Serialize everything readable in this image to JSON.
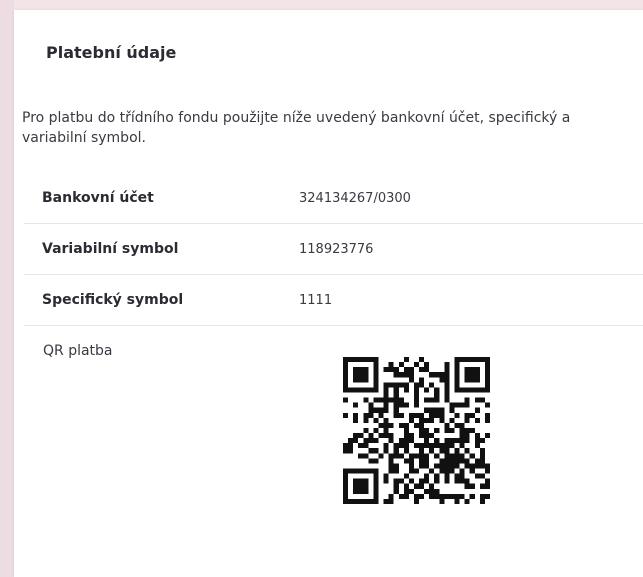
{
  "payment": {
    "title": "Platební údaje",
    "description": "Pro platbu do třídního fondu použijte níže uvedený bankovní účet, specifický a variabilní symbol.",
    "rows": [
      {
        "label": "Bankovní účet",
        "value": "324134267/0300"
      },
      {
        "label": "Variabilní symbol",
        "value": "118923776"
      },
      {
        "label": "Specifický symbol",
        "value": "1111"
      }
    ],
    "qr_label": "QR platba",
    "qr_icon": "qr-code-icon"
  },
  "colors": {
    "background": "#f3e4e8",
    "card": "#ffffff",
    "text": "#2b2b33",
    "divider": "#e6e6ea"
  }
}
